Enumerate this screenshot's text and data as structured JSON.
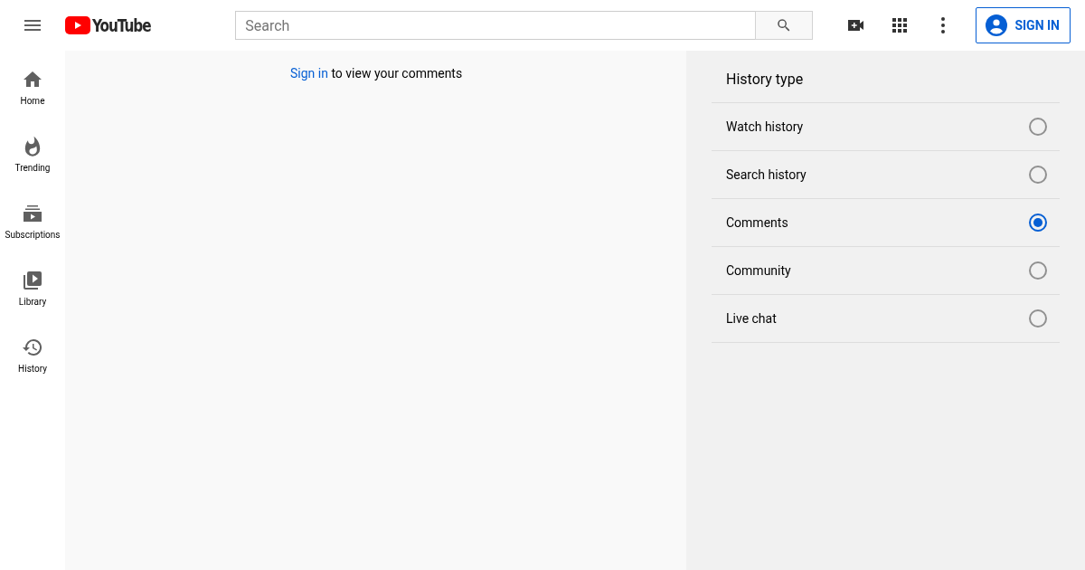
{
  "header": {
    "logo_text": "YouTube",
    "search": {
      "placeholder": "Search"
    },
    "sign_in_button": "SIGN IN"
  },
  "sidebar": {
    "items": [
      {
        "label": "Home",
        "selected": false
      },
      {
        "label": "Trending",
        "selected": false
      },
      {
        "label": "Subscriptions",
        "selected": false
      },
      {
        "label": "Library",
        "selected": false
      },
      {
        "label": "History",
        "selected": false
      }
    ]
  },
  "main": {
    "signin_prompt": {
      "link": "Sign in",
      "text": "to view your comments"
    }
  },
  "history_panel": {
    "title": "History type",
    "options": [
      {
        "label": "Watch history",
        "selected": false
      },
      {
        "label": "Search history",
        "selected": false
      },
      {
        "label": "Comments",
        "selected": true
      },
      {
        "label": "Community",
        "selected": false
      },
      {
        "label": "Live chat",
        "selected": false
      }
    ]
  }
}
